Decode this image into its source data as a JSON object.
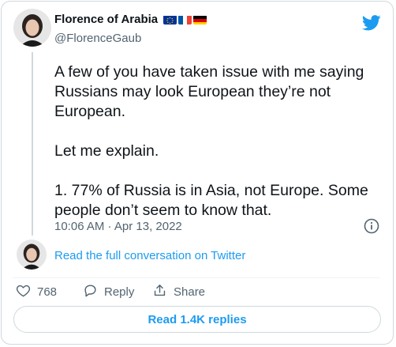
{
  "author": {
    "display_name": "Florence of Arabia",
    "handle": "@FlorenceGaub",
    "flags": [
      "eu-flag-icon",
      "france-flag-icon",
      "germany-flag-icon"
    ]
  },
  "tweet": {
    "text": "A few of you have taken issue with me saying Russians may look European they’re not European.\n\nLet me explain.\n\n1. 77% of Russia is in Asia, not Europe. Some people don’t seem to know that.",
    "timestamp": "10:06 AM · Apr 13, 2022"
  },
  "thread_link": "Read the full conversation on Twitter",
  "actions": {
    "like_count": "768",
    "reply_label": "Reply",
    "share_label": "Share"
  },
  "replies_button": "Read 1.4K replies",
  "colors": {
    "accent": "#1d9bf0",
    "secondary_text": "#536471",
    "border": "#cfd9de"
  }
}
